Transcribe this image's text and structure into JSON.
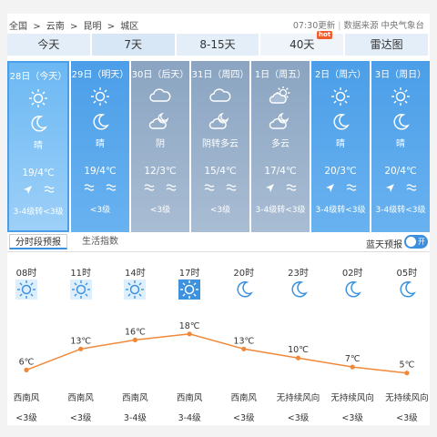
{
  "header": {
    "breadcrumb": [
      "全国",
      ">",
      "云南",
      ">",
      "昆明",
      ">",
      "城区"
    ],
    "update_time": "07:30更新",
    "source": "数据来源 中央气象台"
  },
  "tabs": [
    {
      "label": "今天",
      "active": false
    },
    {
      "label": "7天",
      "active": true
    },
    {
      "label": "8-15天",
      "active": false
    },
    {
      "label": "40天",
      "active": false,
      "badge": "hot"
    },
    {
      "label": "雷达图",
      "active": false
    }
  ],
  "days": [
    {
      "date": "28日（今天）",
      "day_icon": "sun-icon",
      "night_icon": "moon-icon",
      "cond": "晴",
      "temp": "19/4℃",
      "wind_icons": [
        "arrow-icon",
        "wave-icon"
      ],
      "level": "3-4级转<3级",
      "style": "today"
    },
    {
      "date": "29日（明天）",
      "day_icon": "sun-icon",
      "night_icon": "moon-icon",
      "cond": "晴",
      "temp": "19/4℃",
      "wind_icons": [
        "wave-icon",
        "wave-icon"
      ],
      "level": "<3级",
      "style": "sunny"
    },
    {
      "date": "30日（后天）",
      "day_icon": "cloud-icon",
      "night_icon": "cloud-moon-icon",
      "cond": "阴",
      "temp": "12/3℃",
      "wind_icons": [
        "wave-icon",
        "wave-icon"
      ],
      "level": "<3级",
      "style": "cloud"
    },
    {
      "date": "31日（周四）",
      "day_icon": "cloud-icon",
      "night_icon": "cloud-moon-icon",
      "cond": "阴转多云",
      "temp": "15/4℃",
      "wind_icons": [
        "wave-icon",
        "wave-icon"
      ],
      "level": "<3级",
      "style": "cloud"
    },
    {
      "date": "1日（周五）",
      "day_icon": "sun-cloud-icon",
      "night_icon": "cloud-moon-icon",
      "cond": "多云",
      "temp": "17/4℃",
      "wind_icons": [
        "arrow-icon",
        "wave-icon"
      ],
      "level": "3-4级转<3级",
      "style": "cloud"
    },
    {
      "date": "2日（周六）",
      "day_icon": "sun-icon",
      "night_icon": "moon-icon",
      "cond": "晴",
      "temp": "20/3℃",
      "wind_icons": [
        "arrow-icon",
        "wave-icon"
      ],
      "level": "3-4级转<3级",
      "style": "sunny"
    },
    {
      "date": "3日（周日）",
      "day_icon": "sun-icon",
      "night_icon": "moon-icon",
      "cond": "晴",
      "temp": "20/4℃",
      "wind_icons": [
        "arrow-icon",
        "wave-icon"
      ],
      "level": "3-4级转<3级",
      "style": "sunny"
    }
  ],
  "subtabs": {
    "forecast": "分时段预报",
    "index": "生活指数",
    "radar": "蓝天预报",
    "toggle": "开"
  },
  "hourly": [
    {
      "time": "08时",
      "icon": "sun-icon",
      "temp": "6℃",
      "t": 6,
      "wind": "西南风",
      "level": "<3级"
    },
    {
      "time": "11时",
      "icon": "sun-icon",
      "temp": "13℃",
      "t": 13,
      "wind": "西南风",
      "level": "<3级"
    },
    {
      "time": "14时",
      "icon": "sun-icon",
      "temp": "16℃",
      "t": 16,
      "wind": "西南风",
      "level": "3-4级"
    },
    {
      "time": "17时",
      "icon": "sun-icon-strong",
      "temp": "18℃",
      "t": 18,
      "wind": "西南风",
      "level": "3-4级"
    },
    {
      "time": "20时",
      "icon": "moon-icon",
      "temp": "13℃",
      "t": 13,
      "wind": "西南风",
      "level": "<3级"
    },
    {
      "time": "23时",
      "icon": "moon-icon",
      "temp": "10℃",
      "t": 10,
      "wind": "无持续风向",
      "level": "<3级"
    },
    {
      "time": "02时",
      "icon": "moon-icon",
      "temp": "7℃",
      "t": 7,
      "wind": "无持续风向",
      "level": "<3级"
    },
    {
      "time": "05时",
      "icon": "moon-icon",
      "temp": "5℃",
      "t": 5,
      "wind": "无持续风向",
      "level": "<3级"
    }
  ],
  "colors": {
    "line": "#f0883a",
    "accent": "#3b8fdd"
  }
}
